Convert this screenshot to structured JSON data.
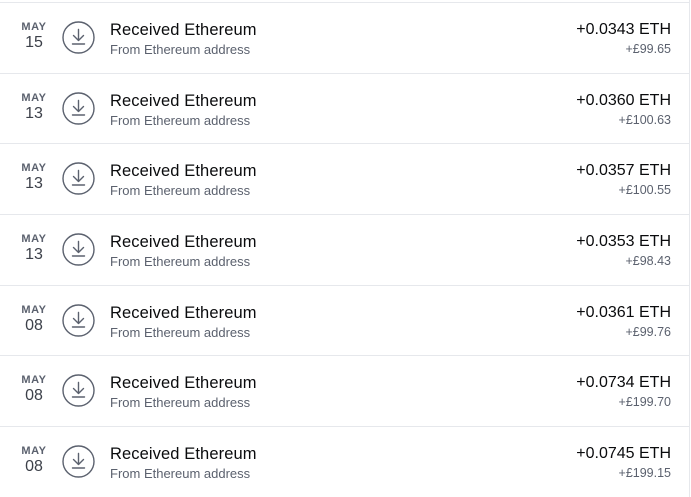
{
  "transactions": [
    {
      "month": "MAY",
      "day": "15",
      "title": "Received Ethereum",
      "subtitle": "From Ethereum address",
      "crypto": "+0.0343 ETH",
      "fiat": "+£99.65",
      "icon": "download-icon"
    },
    {
      "month": "MAY",
      "day": "13",
      "title": "Received Ethereum",
      "subtitle": "From Ethereum address",
      "crypto": "+0.0360 ETH",
      "fiat": "+£100.63",
      "icon": "download-icon"
    },
    {
      "month": "MAY",
      "day": "13",
      "title": "Received Ethereum",
      "subtitle": "From Ethereum address",
      "crypto": "+0.0357 ETH",
      "fiat": "+£100.55",
      "icon": "download-icon"
    },
    {
      "month": "MAY",
      "day": "13",
      "title": "Received Ethereum",
      "subtitle": "From Ethereum address",
      "crypto": "+0.0353 ETH",
      "fiat": "+£98.43",
      "icon": "download-icon"
    },
    {
      "month": "MAY",
      "day": "08",
      "title": "Received Ethereum",
      "subtitle": "From Ethereum address",
      "crypto": "+0.0361 ETH",
      "fiat": "+£99.76",
      "icon": "download-icon"
    },
    {
      "month": "MAY",
      "day": "08",
      "title": "Received Ethereum",
      "subtitle": "From Ethereum address",
      "crypto": "+0.0734 ETH",
      "fiat": "+£199.70",
      "icon": "download-icon"
    },
    {
      "month": "MAY",
      "day": "08",
      "title": "Received Ethereum",
      "subtitle": "From Ethereum address",
      "crypto": "+0.0745 ETH",
      "fiat": "+£199.15",
      "icon": "download-icon"
    }
  ],
  "colors": {
    "divider": "#e6e8ec",
    "secondary_text": "#5b616e",
    "primary_text": "#0a0b0d",
    "icon_stroke": "#5b616e"
  }
}
